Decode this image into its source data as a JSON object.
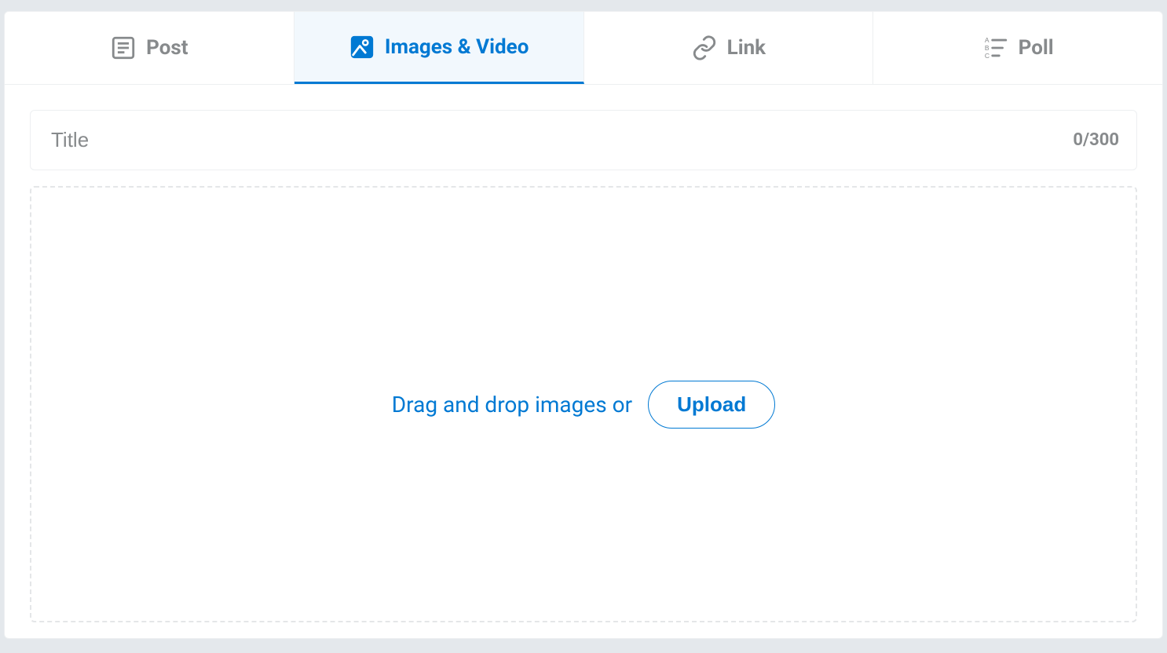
{
  "tabs": {
    "post": {
      "label": "Post"
    },
    "images": {
      "label": "Images & Video"
    },
    "link": {
      "label": "Link"
    },
    "poll": {
      "label": "Poll"
    }
  },
  "title_field": {
    "placeholder": "Title",
    "value": "",
    "counter": "0/300"
  },
  "dropzone": {
    "text": "Drag and drop images or",
    "button": "Upload"
  },
  "colors": {
    "accent": "#0079d3",
    "muted": "#878a8c"
  }
}
